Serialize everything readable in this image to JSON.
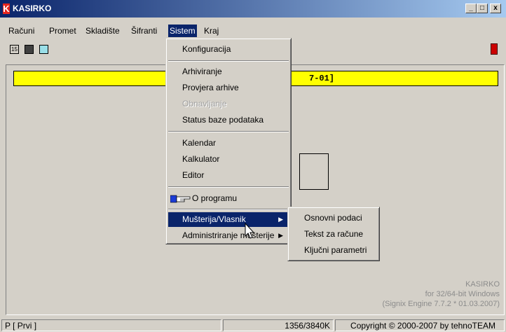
{
  "window": {
    "title": "KASIRKO",
    "logo_letter": "K",
    "minimize": "_",
    "maximize": "□",
    "close": "x"
  },
  "menubar": [
    "Računi",
    "Promet",
    "Skladište",
    "Šifranti",
    "Sistem",
    "Kraj"
  ],
  "toolbar": {
    "calendar_icon_text": "15"
  },
  "main": {
    "yellow_bar_text": "7-01]",
    "brand": [
      "KASIRKO",
      "for 32/64-bit Windows",
      "(Signix Engine 7.7.2 * 01.03.2007)"
    ]
  },
  "sistem_menu": {
    "items": [
      "Konfiguracija",
      "Arhiviranje",
      "Provjera arhive",
      "Obnavljanje",
      "Status baze podataka",
      "Kalendar",
      "Kalkulator",
      "Editor",
      "O programu",
      "Mušterija/Vlasnik",
      "Administriranje mušterije"
    ],
    "submenu_arrow": "▶"
  },
  "musterija_submenu": [
    "Osnovni podaci",
    "Tekst za račune",
    "Ključni parametri"
  ],
  "statusbar": {
    "user": "P [ Prvi ]",
    "memory": "1356/3840K",
    "copyright": "Copyright © 2000-2007 by tehnoTEAM"
  },
  "colors": {
    "titlebar_start": "#0a246a",
    "titlebar_end": "#a6caf0",
    "highlight": "#0a246a",
    "yellow": "#ffff00",
    "logo_red": "#e8261e"
  }
}
